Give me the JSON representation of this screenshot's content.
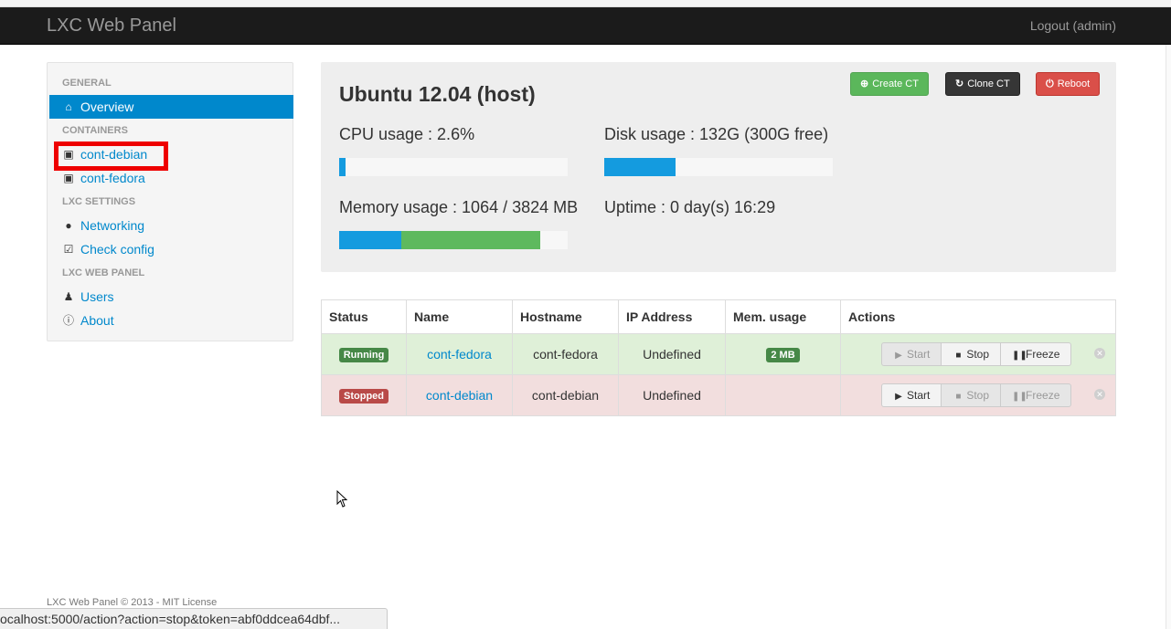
{
  "navbar": {
    "brand": "LXC Web Panel",
    "logout": "Logout (admin)"
  },
  "sidebar": {
    "general_header": "GENERAL",
    "overview": "Overview",
    "containers_header": "CONTAINERS",
    "containers": [
      "cont-debian",
      "cont-fedora"
    ],
    "lxc_settings_header": "LXC SETTINGS",
    "networking": "Networking",
    "check_config": "Check config",
    "panel_header": "LXC WEB PANEL",
    "users": "Users",
    "about": "About"
  },
  "host": {
    "title": "Ubuntu 12.04 (host)",
    "create_button": "Create CT",
    "clone_button": "Clone CT",
    "reboot_button": "Reboot",
    "cpu_label": "CPU usage : 2.6%",
    "cpu_percent": 2.6,
    "disk_label": "Disk usage : 132G (300G free)",
    "disk_percent": 31,
    "memory_label": "Memory usage : 1064 / 3824 MB",
    "memory_used_percent": 27,
    "memory_cached_percent": 61,
    "uptime_label": "Uptime : 0 day(s) 16:29"
  },
  "table": {
    "headers": [
      "Status",
      "Name",
      "Hostname",
      "IP Address",
      "Mem. usage",
      "Actions"
    ],
    "rows": [
      {
        "status": "Running",
        "name": "cont-fedora",
        "hostname": "cont-fedora",
        "ip": "Undefined",
        "mem": "2 MB"
      },
      {
        "status": "Stopped",
        "name": "cont-debian",
        "hostname": "cont-debian",
        "ip": "Undefined",
        "mem": ""
      }
    ],
    "start_label": "Start",
    "stop_label": "Stop",
    "freeze_label": "Freeze"
  },
  "footer": "LXC Web Panel © 2013 - MIT License",
  "statusbar": "ocalhost:5000/action?action=stop&token=abf0ddcea64dbf...",
  "colors": {
    "accent": "#0088cc",
    "success": "#5bb75b",
    "danger": "#da4f49",
    "navbar": "#1b1b1b"
  }
}
